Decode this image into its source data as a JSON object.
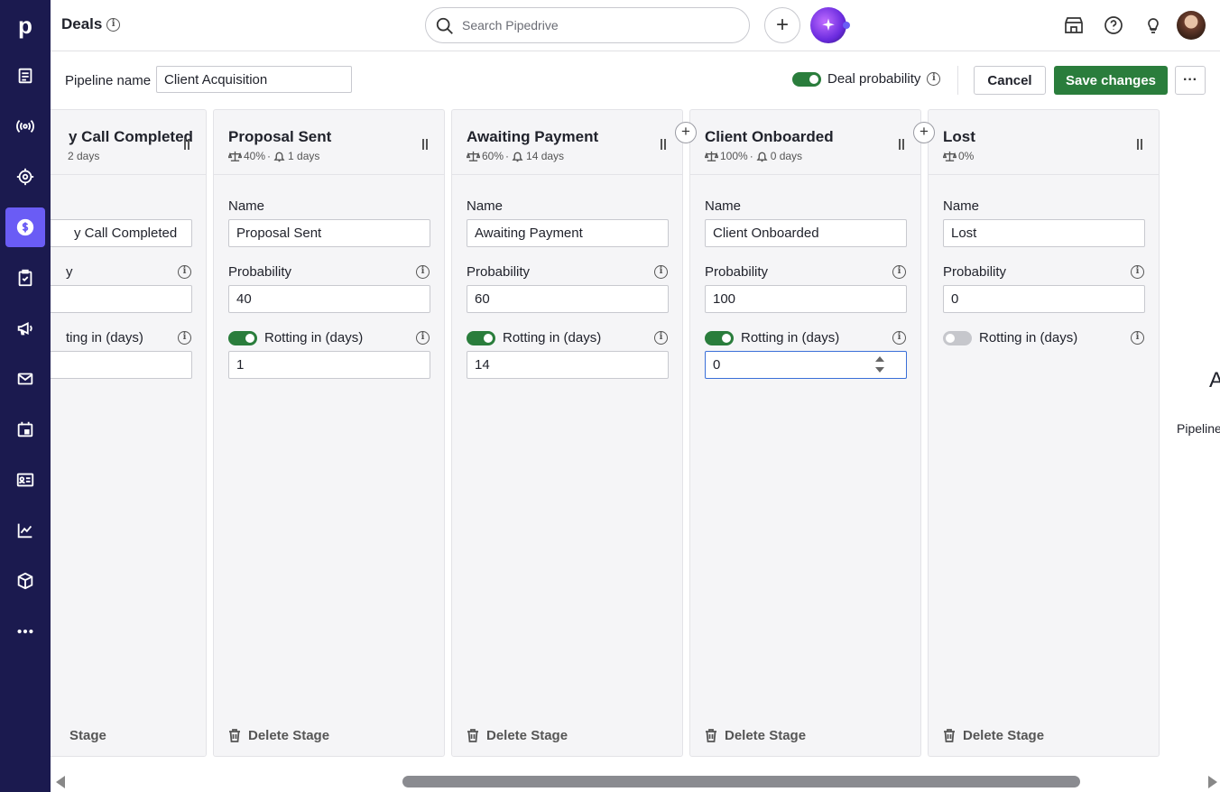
{
  "rail": {
    "logo": "p",
    "items": [
      {
        "icon": "document-icon"
      },
      {
        "icon": "broadcast-icon"
      },
      {
        "icon": "target-icon"
      },
      {
        "icon": "dollar-icon",
        "active": true
      },
      {
        "icon": "clipboard-check-icon"
      },
      {
        "icon": "megaphone-icon"
      },
      {
        "icon": "mail-icon"
      },
      {
        "icon": "calendar-icon"
      },
      {
        "icon": "contacts-card-icon"
      },
      {
        "icon": "chart-icon"
      },
      {
        "icon": "box-icon"
      },
      {
        "icon": "more-horizontal-icon"
      }
    ]
  },
  "header": {
    "title": "Deals",
    "search_placeholder": "Search Pipedrive"
  },
  "pipeline": {
    "name_label": "Pipeline name",
    "name_value": "Client Acquisition",
    "deal_probability_label": "Deal probability",
    "cancel_label": "Cancel",
    "save_label": "Save changes",
    "more_label": "···"
  },
  "labels": {
    "name": "Name",
    "probability": "Probability",
    "rotting": "Rotting in (days)",
    "delete": "Delete Stage"
  },
  "stages": [
    {
      "title": "y Call Completed",
      "meta_rot": "2 days",
      "name": "y Call Completed",
      "probability": "",
      "rotting": "",
      "prob_label": "y",
      "rot_label": "ting in (days)",
      "del_label": "Stage"
    },
    {
      "title": "Proposal Sent",
      "meta_prob": "40%",
      "meta_rot": "1 days",
      "name": "Proposal Sent",
      "probability": "40",
      "rotting_on": true,
      "rotting": "1"
    },
    {
      "title": "Awaiting Payment",
      "meta_prob": "60%",
      "meta_rot": "14 days",
      "name": "Awaiting Payment",
      "probability": "60",
      "rotting_on": true,
      "rotting": "14"
    },
    {
      "title": "Client Onboarded",
      "meta_prob": "100%",
      "meta_rot": "0 days",
      "name": "Client Onboarded",
      "probability": "100",
      "rotting_on": true,
      "rotting": "0"
    },
    {
      "title": "Lost",
      "meta_prob": "0%",
      "name": "Lost",
      "probability": "0",
      "rotting_on": false
    }
  ],
  "offscreen": {
    "letter": "A",
    "text": "Pipeline"
  },
  "colors": {
    "rail": "#1b1a4f",
    "accent": "#6a5cf5",
    "success": "#2a7d3c"
  }
}
